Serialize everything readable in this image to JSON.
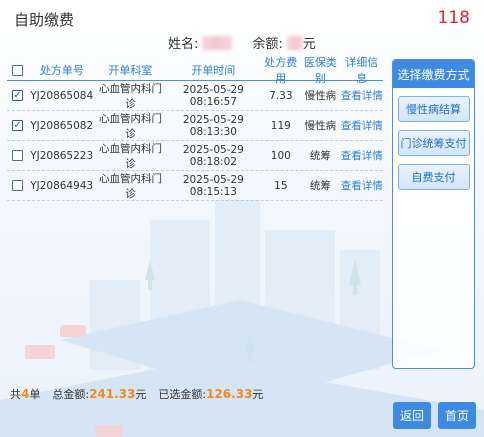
{
  "header": {
    "title": "自助缴费",
    "countdown": "118"
  },
  "patient": {
    "name_label": "姓名:",
    "balance_label": "余额:",
    "balance_unit": "元"
  },
  "table": {
    "columns": [
      "处方单号",
      "开单科室",
      "开单时间",
      "处方费用",
      "医保类别",
      "详细信息"
    ],
    "rows": [
      {
        "checked": true,
        "no": "YJ20865084",
        "dept": "心血管内科门诊",
        "time": "2025-05-29 08:16:57",
        "fee": "7.33",
        "type": "慢性病",
        "detail": "查看详情"
      },
      {
        "checked": true,
        "no": "YJ20865082",
        "dept": "心血管内科门诊",
        "time": "2025-05-29 08:13:30",
        "fee": "119",
        "type": "慢性病",
        "detail": "查看详情"
      },
      {
        "checked": false,
        "no": "YJ20865223",
        "dept": "心血管内科门诊",
        "time": "2025-05-29 08:18:02",
        "fee": "100",
        "type": "统筹",
        "detail": "查看详情"
      },
      {
        "checked": false,
        "no": "YJ20864943",
        "dept": "心血管内科门诊",
        "time": "2025-05-29 08:15:13",
        "fee": "15",
        "type": "统筹",
        "detail": "查看详情"
      }
    ]
  },
  "payment": {
    "header": "选择缴费方式",
    "options": [
      "慢性病结算",
      "门诊统筹支付",
      "自费支付"
    ]
  },
  "summary": {
    "count_prefix": "共",
    "count": "4",
    "count_suffix": "单",
    "total_label": "总金额:",
    "total_value": "241.33",
    "total_unit": "元",
    "selected_label": "已选金额:",
    "selected_value": "126.33",
    "selected_unit": "元"
  },
  "nav": {
    "back": "返回",
    "home": "首页"
  },
  "colors": {
    "accent": "#3d8ae0",
    "countdown": "#e0262d",
    "amount": "#f08a1c"
  }
}
